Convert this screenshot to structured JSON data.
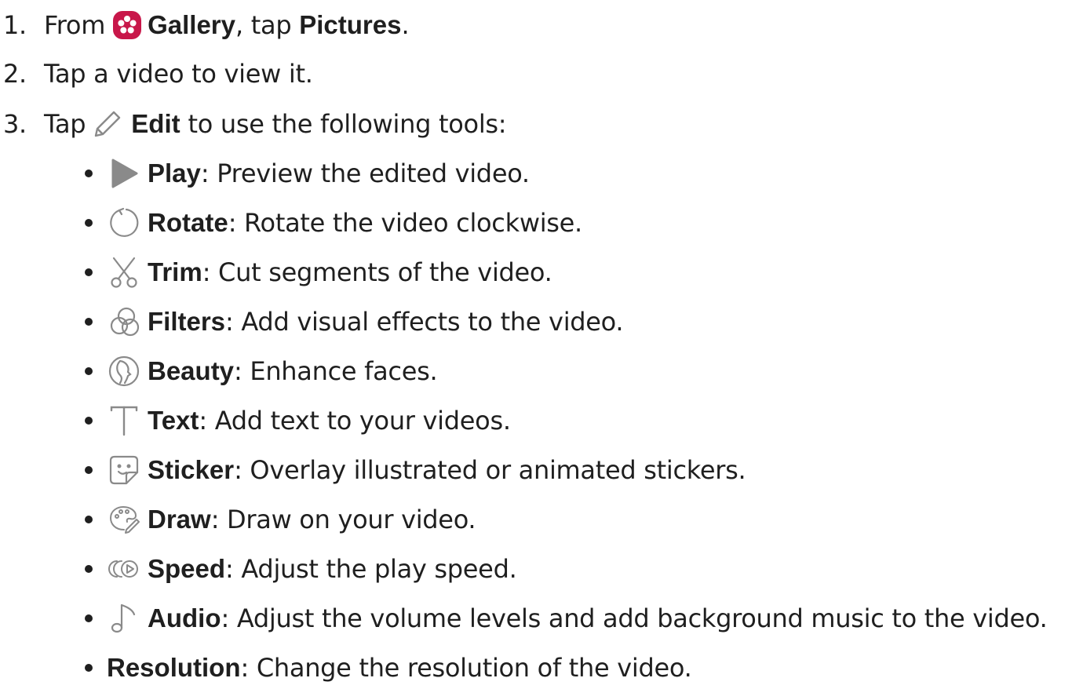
{
  "steps": [
    {
      "number": "1.",
      "prefix": "From",
      "app_name": "Gallery",
      "middle": ", tap ",
      "target": "Pictures",
      "suffix": "."
    },
    {
      "number": "2.",
      "text": "Tap a video to view it."
    },
    {
      "number": "3.",
      "prefix": "Tap",
      "action": "Edit",
      "suffix": " to use the following tools:"
    }
  ],
  "tools": [
    {
      "icon": "play-icon",
      "name": "Play",
      "desc": ": Preview the edited video."
    },
    {
      "icon": "rotate-icon",
      "name": "Rotate",
      "desc": ": Rotate the video clockwise."
    },
    {
      "icon": "scissors-icon",
      "name": "Trim",
      "desc": ": Cut segments of the video."
    },
    {
      "icon": "filters-icon",
      "name": "Filters",
      "desc": ": Add visual effects to the video."
    },
    {
      "icon": "beauty-icon",
      "name": "Beauty",
      "desc": ": Enhance faces."
    },
    {
      "icon": "text-icon",
      "name": "Text",
      "desc": ": Add text to your videos."
    },
    {
      "icon": "sticker-icon",
      "name": "Sticker",
      "desc": ": Overlay illustrated or animated stickers."
    },
    {
      "icon": "draw-icon",
      "name": "Draw",
      "desc": ": Draw on your video."
    },
    {
      "icon": "speed-icon",
      "name": "Speed",
      "desc": ": Adjust the play speed."
    },
    {
      "icon": "audio-icon",
      "name": "Audio",
      "desc": ": Adjust the volume levels and add background music to the video."
    },
    {
      "icon": "",
      "name": "Resolution",
      "desc": ": Change the resolution of the video."
    }
  ],
  "colors": {
    "text": "#1f1f1f",
    "icon_gray": "#8a8a8a",
    "gallery_red": "#c8174a"
  }
}
